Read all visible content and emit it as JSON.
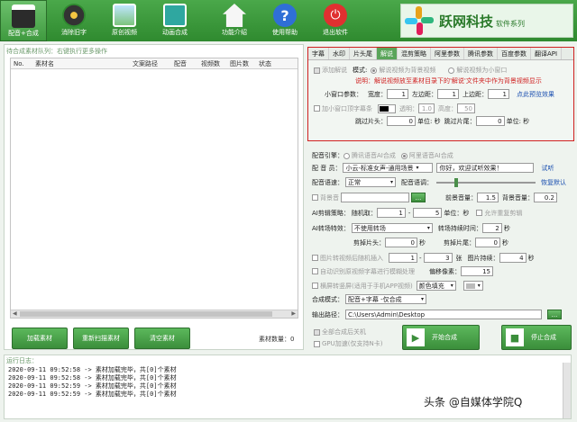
{
  "toolbar": {
    "items": [
      {
        "label": "配音+合成",
        "icon": "clapperboard-icon",
        "active": true
      },
      {
        "label": "消除旧字",
        "icon": "film-reel-icon"
      },
      {
        "label": "原创视频",
        "icon": "picture-icon"
      },
      {
        "label": "动画合成",
        "icon": "movie-icon"
      },
      {
        "label": "功能介绍",
        "icon": "home-icon"
      },
      {
        "label": "使用帮助",
        "icon": "help-icon"
      },
      {
        "label": "退出软件",
        "icon": "power-icon"
      }
    ],
    "brand_title": "跃网科技",
    "brand_sub": "软件系列"
  },
  "left": {
    "title": "待合成素材队列：右键执行更多操作",
    "columns": [
      "No.",
      "素材名",
      "文案路径",
      "配音",
      "视频数",
      "图片数",
      "状态"
    ],
    "buttons": {
      "load": "加载素材",
      "rescan": "重新扫描素材",
      "clear": "清空素材"
    },
    "count_label": "素材数量：",
    "count_value": "0"
  },
  "tabs": [
    "字幕",
    "水印",
    "片头尾",
    "解说",
    "混剪策略",
    "阿里参数",
    "腾讯参数",
    "百度参数",
    "翻译API"
  ],
  "explain": {
    "add_explain": "添加解说",
    "mode_label": "模式:",
    "mode_bg": "解说视频为背景视频",
    "mode_small": "解说视频为小窗口",
    "note": "说明：解说视频放至素材目录下的'解说'文件夹中作为背景视频显示",
    "small_params": "小窗口参数：",
    "width_label": "宽度：",
    "width_val": "1",
    "left_margin": "左边距：",
    "left_val": "1",
    "top_margin": "上边距：",
    "top_val": "1",
    "preview": "点此预览效果",
    "add_mask": "加小窗口顶字幕条",
    "opacity_label": "透明：",
    "opacity_val": "1.0",
    "height_label": "高度：",
    "height_val": "50",
    "skip_head": "跳过片头：",
    "skip_head_val": "0",
    "unit": "单位: 秒",
    "skip_tail": "跳过片尾：",
    "skip_tail_val": "0"
  },
  "dub": {
    "engine_label": "配音引擎：",
    "engine_tx": "腾讯语音AI合成",
    "engine_ali": "阿里语音AI合成",
    "voice_label": "配 音 员：",
    "voice_val": "小云-标准女声-通用场景",
    "sample_text": "你好，欢迎试听效果！",
    "audition": "试听",
    "speed_label": "配音语速：",
    "speed_val": "正常",
    "pitch_label": "配音语调：",
    "reset": "恢复默认",
    "bgm_label": "背景音",
    "fg_vol_label": "前景音量：",
    "fg_vol": "1.5",
    "bg_vol_label": "背景音量：",
    "bg_vol": "0.2",
    "clip_label": "AI剪辑策略：",
    "random_label": "随机取：",
    "rand_min": "1",
    "rand_max": "5",
    "unit_sec": "单位：秒",
    "allow_repeat": "允许重复剪辑",
    "transition_label": "AI转场特效：",
    "transition_val": "不使用转场",
    "transition_dur_label": "转场持续时间：",
    "transition_dur": "2",
    "sec": "秒",
    "cut_head_label": "剪掉片头：",
    "cut_head": "0",
    "cut_tail_label": "剪掉片尾：",
    "cut_tail": "0",
    "img_random": "图片转视频后随机插入",
    "img_min": "1",
    "img_max": "3",
    "zhang": "张",
    "img_dur_label": "图片持续：",
    "img_dur": "4",
    "auto_detect": "自动识别原视频字幕进行模糊处理",
    "offset_label": "偏移像素：",
    "offset": "15",
    "landscape": "横屏转竖屏(适用于手机APP视频)",
    "fill_color": "颜色填充",
    "merge_mode_label": "合成模式：",
    "merge_mode": "配音+字幕 -仅合成",
    "out_label": "输出路径：",
    "out_path": "C:\\Users\\Admin\\Desktop",
    "shutdown": "全部合成后关机",
    "gpu": "GPU加速(仅支持N卡)",
    "start": "开始合成",
    "stop": "停止合成"
  },
  "log": {
    "title": "运行日志：",
    "lines": [
      "2020-09-11 09:52:58 -> 素材加载完毕，共[0]个素材",
      "2020-09-11 09:52:58 -> 素材加载完毕，共[0]个素材",
      "2020-09-11 09:52:59 -> 素材加载完毕，共[0]个素材",
      "2020-09-11 09:52:59 -> 素材加载完毕，共[0]个素材"
    ]
  },
  "watermark": "头条 @自媒体学院Q"
}
